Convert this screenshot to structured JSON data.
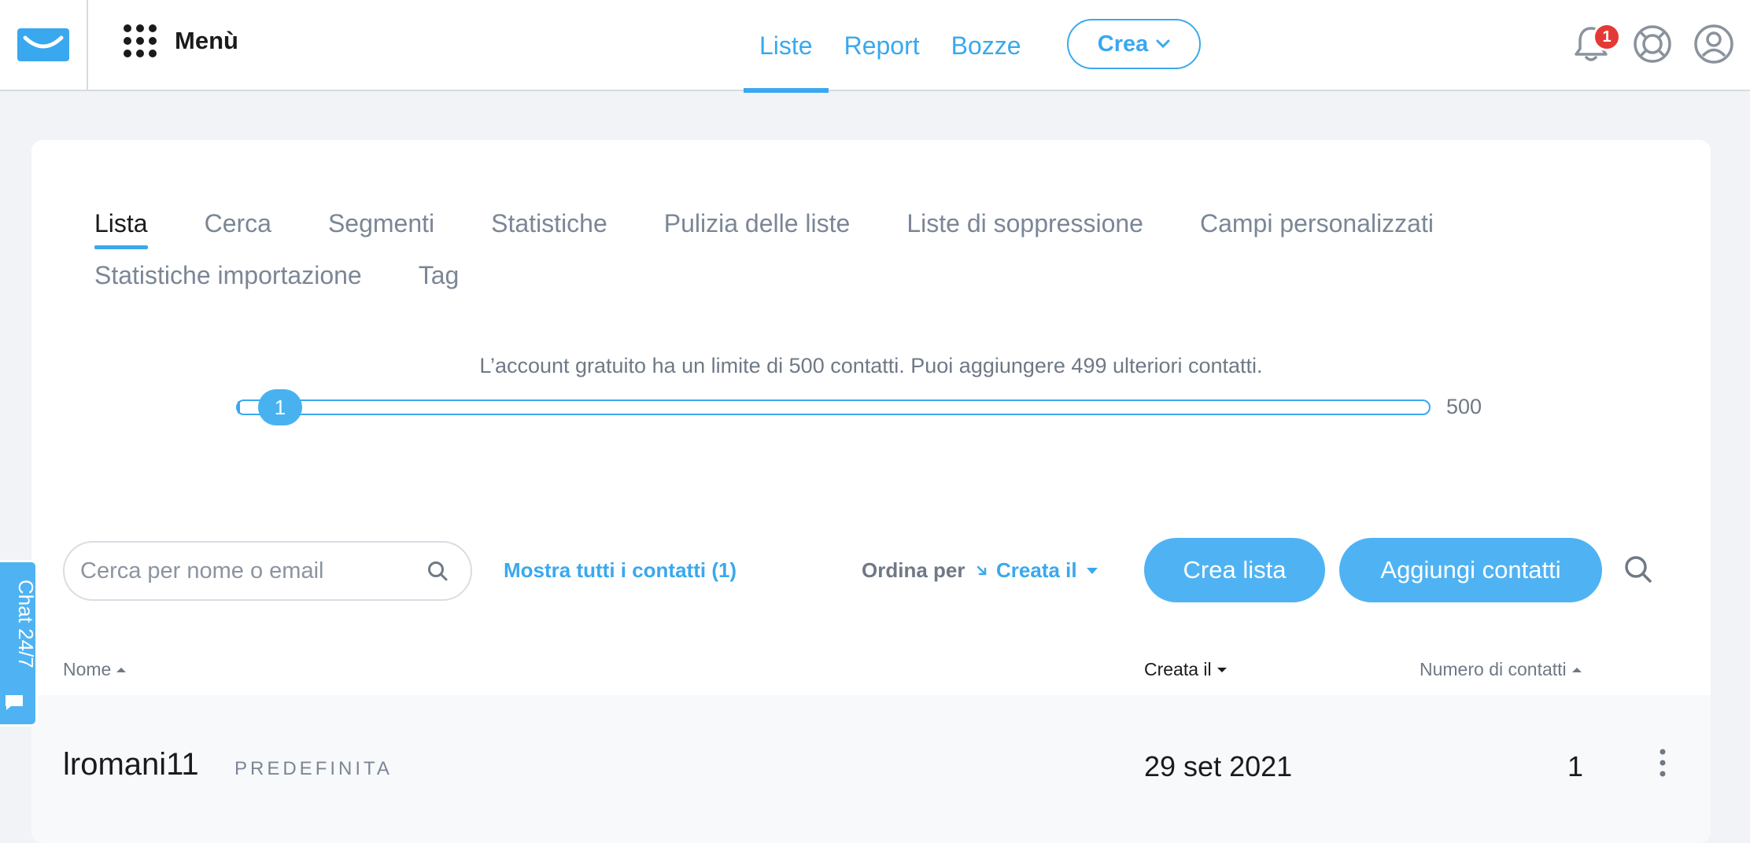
{
  "header": {
    "menu_label": "Menù",
    "nav": [
      {
        "label": "Liste",
        "active": true
      },
      {
        "label": "Report",
        "active": false
      },
      {
        "label": "Bozze",
        "active": false
      }
    ],
    "create_label": "Crea",
    "notification_count": "1"
  },
  "tabs": {
    "row1": [
      "Lista",
      "Cerca",
      "Segmenti",
      "Statistiche",
      "Pulizia delle liste",
      "Liste di soppressione",
      "Campi personalizzati"
    ],
    "row2": [
      "Statistiche importazione",
      "Tag"
    ],
    "active": "Lista"
  },
  "limit": {
    "text": "L’account gratuito ha un limite di 500 contatti. Puoi aggiungere 499 ulteriori contatti.",
    "current": "1",
    "max": "500"
  },
  "toolbar": {
    "search_placeholder": "Cerca per nome o email",
    "show_all": "Mostra tutti i contatti (1)",
    "sort_label": "Ordina per",
    "sort_value": "Creata il",
    "create_list": "Crea lista",
    "add_contacts": "Aggiungi contatti"
  },
  "table": {
    "columns": {
      "name": "Nome",
      "created": "Creata il",
      "count": "Numero di contatti"
    },
    "rows": [
      {
        "name": "lromani11",
        "tag": "PREDEFINITA",
        "created": "29 set 2021",
        "count": "1"
      }
    ]
  },
  "chat": {
    "label": "Chat 24/7"
  },
  "colors": {
    "accent": "#3aa8ee",
    "button": "#4fb3f3",
    "badge": "#e53935"
  }
}
